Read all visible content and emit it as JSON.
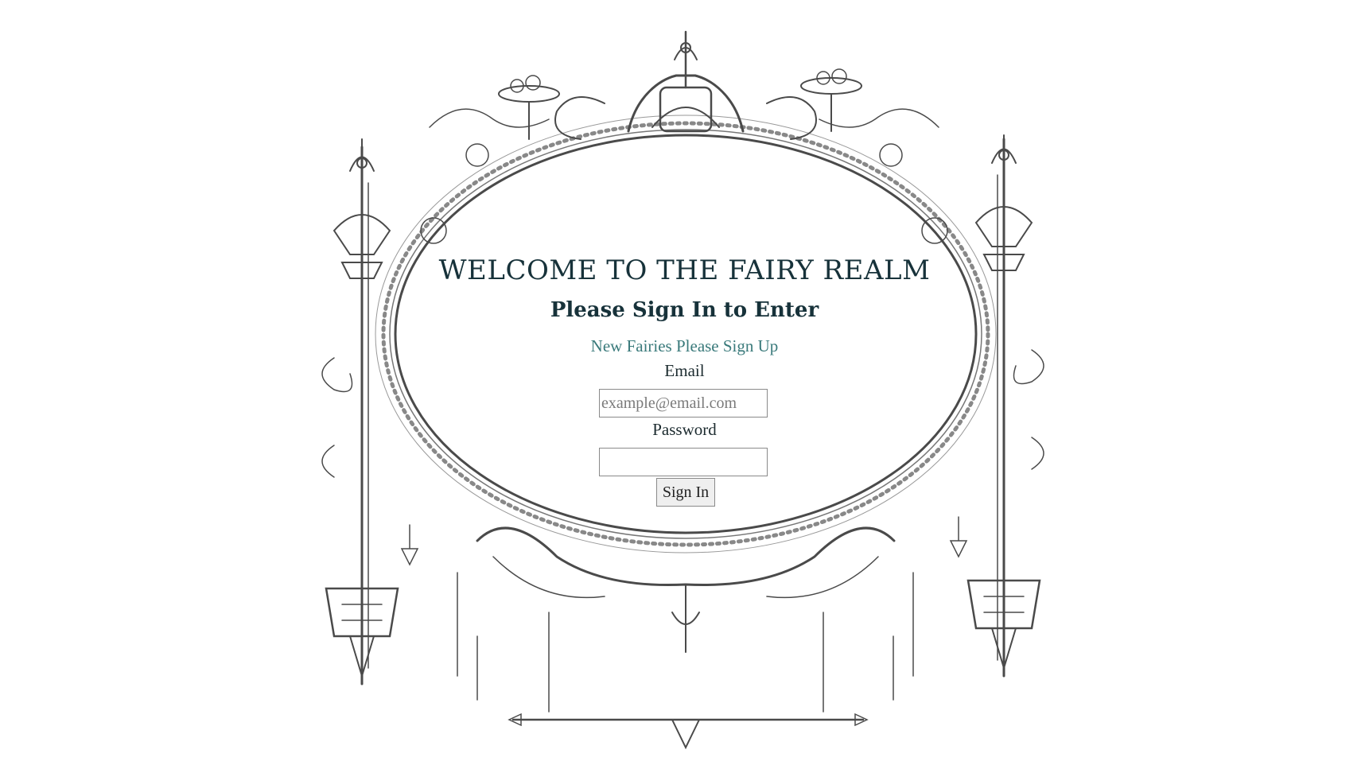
{
  "heading": {
    "title": "WELCOME TO THE FAIRY REALM",
    "subtitle": "Please Sign In to Enter"
  },
  "links": {
    "signup": "New Fairies Please Sign Up"
  },
  "form": {
    "email_label": "Email",
    "email_placeholder": "example@email.com",
    "email_value": "",
    "password_label": "Password",
    "password_value": "",
    "submit_label": "Sign In"
  },
  "colors": {
    "heading": "#17323a",
    "link": "#3a7a7b",
    "frame": "#555555"
  },
  "decor": {
    "frame_icon": "ornate-victorian-frame-icon"
  }
}
